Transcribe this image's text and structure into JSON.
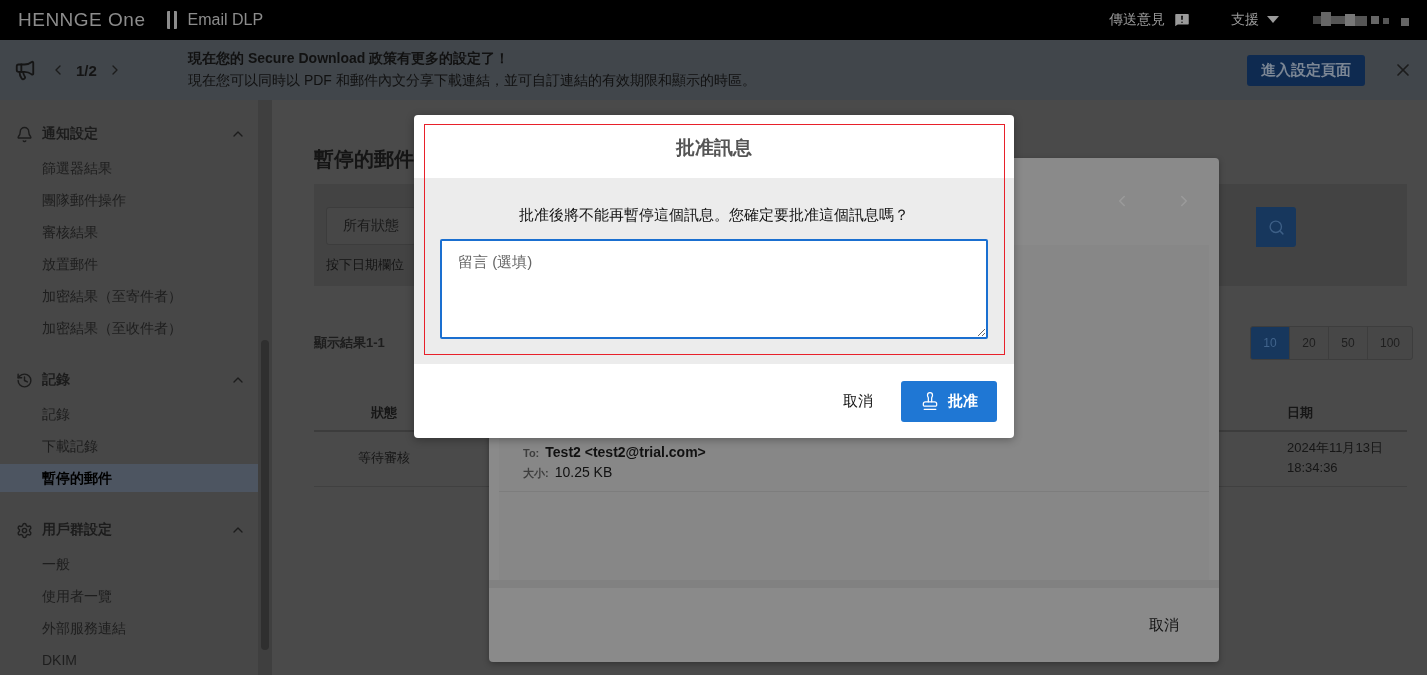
{
  "top_bar": {
    "product_logo": "HENNGE One",
    "app_name": "Email DLP",
    "feedback": "傳送意見",
    "support": "支援"
  },
  "banner": {
    "page": "1/2",
    "title": "現在您的 Secure Download 政策有更多的設定了！",
    "body": "現在您可以同時以 PDF 和郵件內文分享下載連結，並可自訂連結的有效期限和顯示的時區。",
    "action": "進入設定頁面"
  },
  "sidebar": {
    "sections": [
      {
        "title": "通知設定",
        "expanded": true,
        "items": [
          {
            "label": "篩選器結果",
            "selected": false
          },
          {
            "label": "團隊郵件操作",
            "selected": false
          },
          {
            "label": "審核結果",
            "selected": false
          },
          {
            "label": "放置郵件",
            "selected": false
          },
          {
            "label": "加密結果（至寄件者）",
            "selected": false
          },
          {
            "label": "加密結果（至收件者）",
            "selected": false
          }
        ]
      },
      {
        "title": "記錄",
        "expanded": true,
        "items": [
          {
            "label": "記錄",
            "selected": false
          },
          {
            "label": "下載記錄",
            "selected": false
          },
          {
            "label": "暫停的郵件",
            "selected": true
          }
        ]
      },
      {
        "title": "用戶群設定",
        "expanded": true,
        "items": [
          {
            "label": "一般",
            "selected": false
          },
          {
            "label": "使用者一覽",
            "selected": false
          },
          {
            "label": "外部服務連結",
            "selected": false
          },
          {
            "label": "DKIM",
            "selected": false
          }
        ]
      }
    ]
  },
  "page": {
    "title": "暫停的郵件",
    "status_filter": "所有狀態",
    "hint": "按下日期欄位",
    "results": "顯示結果1-1",
    "page_sizes": [
      {
        "label": "10",
        "selected": true
      },
      {
        "label": "20",
        "selected": false
      },
      {
        "label": "50",
        "selected": false
      },
      {
        "label": "100",
        "selected": false
      }
    ],
    "columns": [
      "狀態",
      "日期"
    ],
    "rows": [
      {
        "status": "等待審核",
        "date": "2024年11月13日 18:34:36"
      }
    ]
  },
  "detail_dialog": {
    "to_label": "To:",
    "to": "Test2 <test2@trial.com>",
    "size_label": "大小:",
    "size": "10.25 KB",
    "cancel": "取消"
  },
  "approve_dialog": {
    "title": "批准訊息",
    "message": "批准後將不能再暫停這個訊息。您確定要批准這個訊息嗎？",
    "placeholder": "留言 (選填)",
    "cancel": "取消",
    "approve": "批准"
  }
}
